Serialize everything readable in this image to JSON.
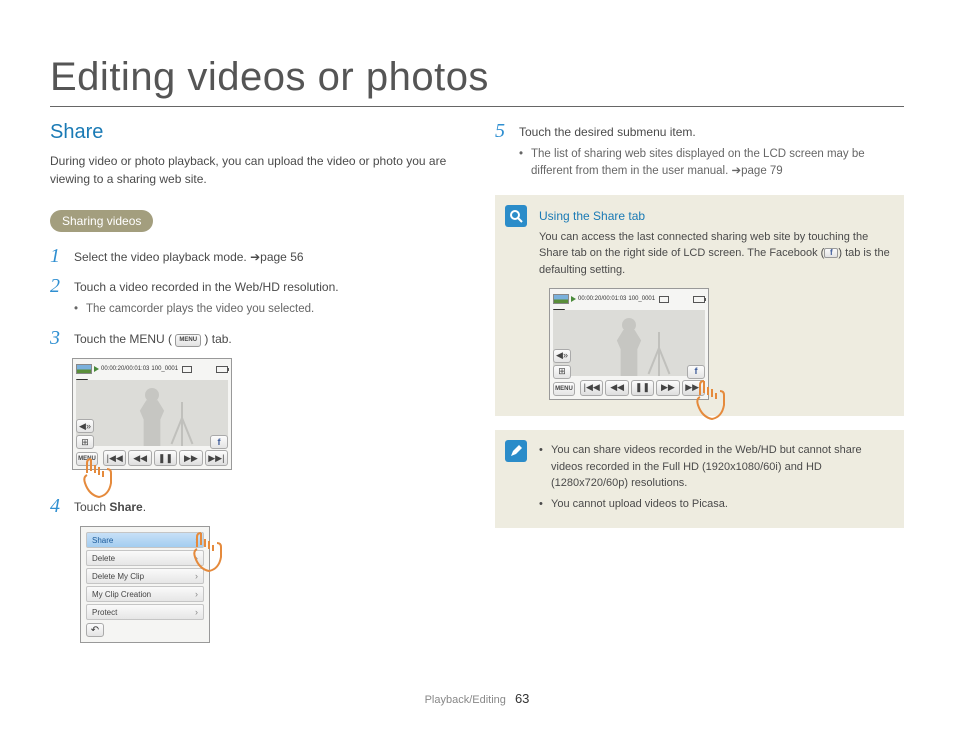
{
  "page_title": "Editing videos or photos",
  "section_title": "Share",
  "intro": "During video or photo playback, you can upload the video or photo you are viewing to a sharing web site.",
  "badge": "Sharing videos",
  "steps": {
    "s1": "Select the video playback mode. ➔page 56",
    "s2": "Touch a video recorded in the Web/HD resolution.",
    "s2_sub": "The camcorder plays the video you selected.",
    "s3_pre": "Touch the MENU (",
    "s3_post": ") tab.",
    "s4_pre": "Touch ",
    "s4_bold": "Share",
    "s4_post": ".",
    "s5": "Touch the desired submenu item.",
    "s5_sub": "The list of sharing web sites displayed on the LCD screen may be different from them in the user manual. ➔page 79"
  },
  "player": {
    "time": "00:00:20/00:01:03",
    "clip": "100_0001",
    "menu": "MENU",
    "vol": "◀»",
    "grid": "⊞"
  },
  "menu_items": [
    "Share",
    "Delete",
    "Delete My Clip",
    "My Clip Creation",
    "Protect"
  ],
  "back": "↶",
  "info1": {
    "title": "Using the Share tab",
    "body_pre": "You can access the last connected sharing web site by touching the Share tab on the right side of LCD screen. The Facebook (",
    "body_post": ") tab is the defaulting setting."
  },
  "info2": {
    "b1": "You can share videos recorded in the Web/HD but cannot share videos recorded in the Full HD (1920x1080/60i) and HD (1280x720/60p) resolutions.",
    "b2": "You cannot upload videos to Picasa."
  },
  "footer_section": "Playback/Editing",
  "page_number": "63",
  "menu_inline": "MENU"
}
